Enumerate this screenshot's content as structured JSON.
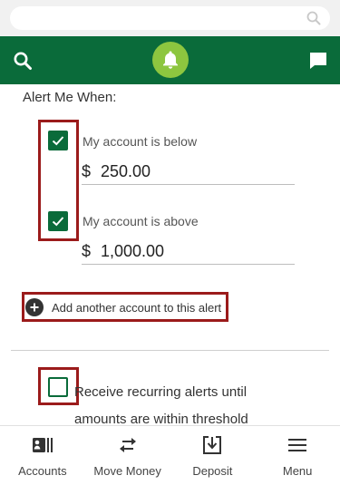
{
  "colors": {
    "brand_green": "#0a6b3a",
    "bell_green": "#8dc63f",
    "highlight_red": "#9b1b1b"
  },
  "browser": {
    "search_icon": "search-icon"
  },
  "header": {
    "left_icon": "search-icon",
    "center_icon": "bell-icon",
    "right_icon": "chat-icon"
  },
  "alert": {
    "section_title": "Alert Me When:",
    "conditions": [
      {
        "label": "My account is below",
        "checked": true,
        "currency": "$",
        "amount": "250.00"
      },
      {
        "label": "My account is above",
        "checked": true,
        "currency": "$",
        "amount": "1,000.00"
      }
    ],
    "add_account_label": "Add another account to this alert",
    "recurring": {
      "checked": false,
      "label": "Receive recurring alerts until amounts are within threshold"
    }
  },
  "bottom_nav": [
    {
      "label": "Accounts",
      "icon": "accounts-icon"
    },
    {
      "label": "Move Money",
      "icon": "transfer-icon"
    },
    {
      "label": "Deposit",
      "icon": "deposit-icon"
    },
    {
      "label": "Menu",
      "icon": "menu-icon"
    }
  ]
}
